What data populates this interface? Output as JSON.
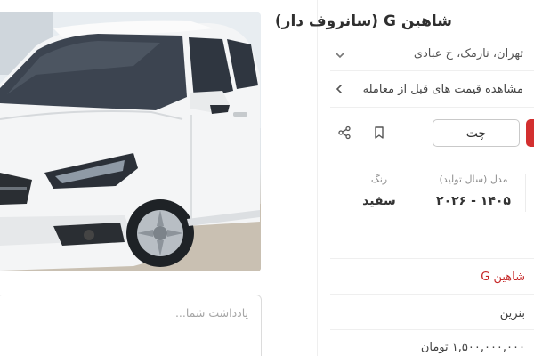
{
  "listing": {
    "title": "شاهین G (سانروف دار)",
    "location": "تهران، نارمک، خ عبادی",
    "previous_deal": "مشاهده قیمت های قبل از معامله"
  },
  "actions": {
    "chat_label": "چت"
  },
  "attributes": {
    "model": {
      "label": "مدل (سال تولید)",
      "value": "۱۴۰۵ - ۲۰۲۶"
    },
    "color": {
      "label": "رنگ",
      "value": "سفید"
    }
  },
  "specs": {
    "name": "شاهین G",
    "fuel": "بنزین",
    "price": "۱,۵۰۰,۰۰۰,۰۰۰ تومان"
  },
  "note": {
    "placeholder": "یادداشت شما..."
  },
  "icons": [
    "share-icon",
    "bookmark-icon",
    "chevron-down-icon",
    "chevron-left-icon"
  ],
  "colors": {
    "accent": "#d32f2f"
  }
}
